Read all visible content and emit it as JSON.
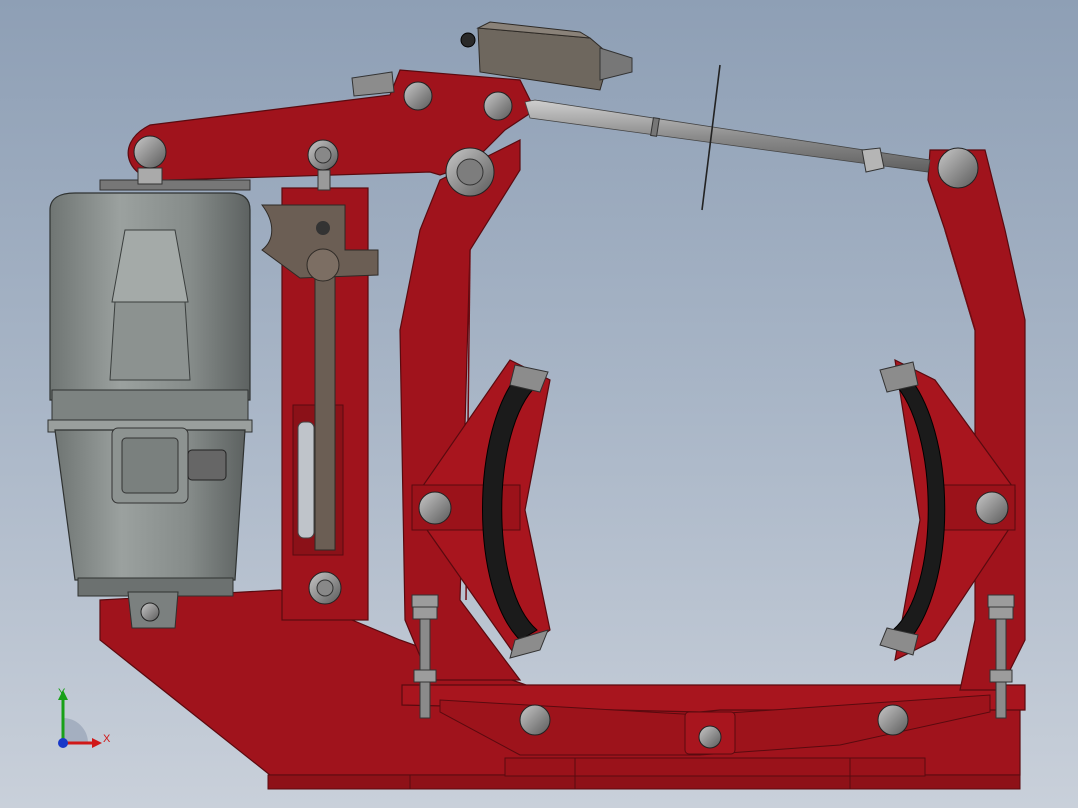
{
  "scene": {
    "description_free": true,
    "colors": {
      "background_top": "#8e9fb5",
      "background_bottom": "#c9d0da",
      "frame_red": "#a0131c",
      "frame_red_dark": "#6f0b12",
      "motor_grey": "#8b918f",
      "motor_dark": "#4c504f",
      "lining_black": "#1b1b1b",
      "rod_grey": "#9a9a9a",
      "bracket_brown": "#6b5e54"
    }
  },
  "triad": {
    "x_label": "X",
    "y_label": "Y",
    "x_color": "#d01818",
    "y_color": "#18a018",
    "z_color": "#1838c8"
  }
}
